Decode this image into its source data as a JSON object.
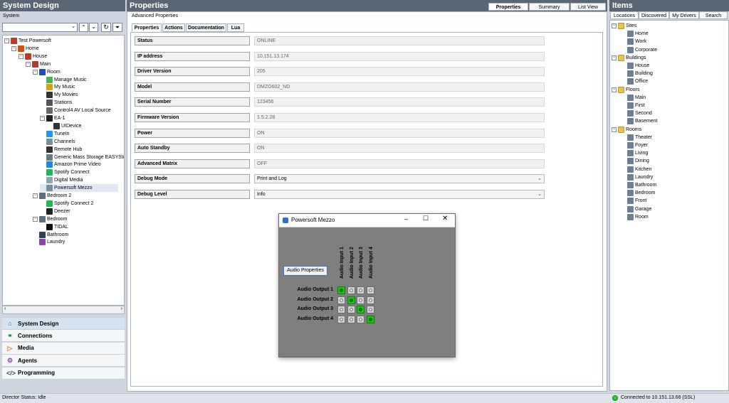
{
  "left": {
    "title": "System Design",
    "subtitle": "System",
    "tree": [
      {
        "label": "Test Powersoft",
        "indent": 0,
        "icon": "project-icon",
        "color": "#c0392b",
        "exp": "-"
      },
      {
        "label": "Home",
        "indent": 1,
        "icon": "home-site-icon",
        "color": "#d35400",
        "exp": "-"
      },
      {
        "label": "House",
        "indent": 2,
        "icon": "house-icon",
        "color": "#c0392b",
        "exp": "-"
      },
      {
        "label": "Main",
        "indent": 3,
        "icon": "floor-icon",
        "color": "#b03a2e",
        "exp": "-"
      },
      {
        "label": "Room",
        "indent": 4,
        "icon": "room-icon",
        "color": "#1f4fb0",
        "exp": "-"
      },
      {
        "label": "Manage Music",
        "indent": 5,
        "icon": "music-icon",
        "color": "#4caf50",
        "exp": ""
      },
      {
        "label": "My Music",
        "indent": 5,
        "icon": "my-music-icon",
        "color": "#d4a017",
        "exp": ""
      },
      {
        "label": "My Movies",
        "indent": 5,
        "icon": "movies-icon",
        "color": "#333333",
        "exp": ""
      },
      {
        "label": "Stations",
        "indent": 5,
        "icon": "stations-icon",
        "color": "#555555",
        "exp": ""
      },
      {
        "label": "Control4 AV Local Source",
        "indent": 5,
        "icon": "av-source-icon",
        "color": "#666666",
        "exp": ""
      },
      {
        "label": "EA-1",
        "indent": 5,
        "icon": "controller-icon",
        "color": "#222222",
        "exp": "-"
      },
      {
        "label": "UIDevice",
        "indent": 6,
        "icon": "uidevice-icon",
        "color": "#333333",
        "exp": ""
      },
      {
        "label": "TuneIn",
        "indent": 5,
        "icon": "tunein-icon",
        "color": "#2196f3",
        "exp": ""
      },
      {
        "label": "Channels",
        "indent": 5,
        "icon": "channels-icon",
        "color": "#78909c",
        "exp": ""
      },
      {
        "label": "Remote Hub",
        "indent": 5,
        "icon": "remote-hub-icon",
        "color": "#333333",
        "exp": ""
      },
      {
        "label": "Generic Mass Storage EASYSW",
        "indent": 5,
        "icon": "storage-icon",
        "color": "#607d8b",
        "exp": ""
      },
      {
        "label": "Amazon Prime Video",
        "indent": 5,
        "icon": "prime-video-icon",
        "color": "#1e88e5",
        "exp": ""
      },
      {
        "label": "Spotify Connect",
        "indent": 5,
        "icon": "spotify-icon",
        "color": "#1db954",
        "exp": ""
      },
      {
        "label": "Digital Media",
        "indent": 5,
        "icon": "digital-media-icon",
        "color": "#90a4ae",
        "exp": ""
      },
      {
        "label": "Powersoft Mezzo",
        "indent": 5,
        "icon": "amplifier-icon",
        "color": "#78909c",
        "exp": "",
        "selected": true
      },
      {
        "label": "Bedroom 2",
        "indent": 4,
        "icon": "bedroom-icon",
        "color": "#5d6d7e",
        "exp": "-"
      },
      {
        "label": "Spotify Connect 2",
        "indent": 5,
        "icon": "spotify-icon",
        "color": "#1db954",
        "exp": ""
      },
      {
        "label": "Deezer",
        "indent": 5,
        "icon": "deezer-icon",
        "color": "#222222",
        "exp": ""
      },
      {
        "label": "Bedroom",
        "indent": 4,
        "icon": "bedroom-icon",
        "color": "#5d6d7e",
        "exp": "-"
      },
      {
        "label": "TIDAL",
        "indent": 5,
        "icon": "tidal-icon",
        "color": "#111111",
        "exp": ""
      },
      {
        "label": "Bathroom",
        "indent": 4,
        "icon": "bathroom-icon",
        "color": "#2e4053",
        "exp": ""
      },
      {
        "label": "Laundry",
        "indent": 4,
        "icon": "laundry-icon",
        "color": "#8e44ad",
        "exp": ""
      }
    ],
    "nav": [
      {
        "label": "System Design",
        "icon": "home-outline-icon",
        "glyph": "⌂",
        "color": "#1f6fb5",
        "selected": true
      },
      {
        "label": "Connections",
        "icon": "connections-icon",
        "glyph": "⚭",
        "color": "#2e8b57"
      },
      {
        "label": "Media",
        "icon": "media-play-icon",
        "glyph": "▷",
        "color": "#e67e22"
      },
      {
        "label": "Agents",
        "icon": "agents-icon",
        "glyph": "⚙",
        "color": "#8e44ad"
      },
      {
        "label": "Programming",
        "icon": "code-icon",
        "glyph": "</>",
        "color": "#444444"
      }
    ]
  },
  "center": {
    "title": "Properties",
    "view_tabs": [
      "Properties",
      "Summary",
      "List View"
    ],
    "breadcrumb": "Advanced Properties",
    "sub_tabs": [
      "Properties",
      "Actions",
      "Documentation",
      "Lua"
    ],
    "props": [
      {
        "label": "Status",
        "value": "ONLINE",
        "dropdown": false
      },
      {
        "label": "IP address",
        "value": "10.151.13.174",
        "dropdown": false
      },
      {
        "label": "Driver Version",
        "value": "205",
        "dropdown": false
      },
      {
        "label": "Model",
        "value": "DMZO602_ND",
        "dropdown": false
      },
      {
        "label": "Serial Number",
        "value": "123456",
        "dropdown": false
      },
      {
        "label": "Firmware Version",
        "value": "1.5.2.28",
        "dropdown": false
      },
      {
        "label": "Power",
        "value": "ON",
        "dropdown": false
      },
      {
        "label": "Auto Standby",
        "value": "ON",
        "dropdown": false
      },
      {
        "label": "Advanced Matrix",
        "value": "OFF",
        "dropdown": false
      },
      {
        "label": "Debug Mode",
        "value": "Print and Log",
        "dropdown": true
      },
      {
        "label": "Debug Level",
        "value": "Info",
        "dropdown": true
      }
    ]
  },
  "dialog": {
    "title": "Powersoft Mezzo",
    "button": "Audio Properties",
    "inputs": [
      "Audio Input 1",
      "Audio Input 2",
      "Audio Input 3",
      "Audio Input 4"
    ],
    "outputs": [
      "Audio Output 1",
      "Audio Output 2",
      "Audio Output 3",
      "Audio Output 4"
    ],
    "matrix": [
      [
        1,
        0,
        0,
        0
      ],
      [
        0,
        1,
        0,
        0
      ],
      [
        0,
        0,
        1,
        0
      ],
      [
        0,
        0,
        0,
        1
      ]
    ],
    "active_color": "#1fc21a"
  },
  "right": {
    "title": "Items",
    "tabs": [
      "Locations",
      "Discovered",
      "My Drivers",
      "Search"
    ],
    "groups": [
      {
        "label": "Sites",
        "items": [
          {
            "label": "Home",
            "icon": "site-home-icon"
          },
          {
            "label": "Work",
            "icon": "site-work-icon"
          },
          {
            "label": "Corporate",
            "icon": "site-corporate-icon"
          }
        ]
      },
      {
        "label": "Buildings",
        "items": [
          {
            "label": "House",
            "icon": "house-icon"
          },
          {
            "label": "Building",
            "icon": "building-icon"
          },
          {
            "label": "Office",
            "icon": "office-icon"
          }
        ]
      },
      {
        "label": "Floors",
        "items": [
          {
            "label": "Main",
            "icon": "floor-main-icon"
          },
          {
            "label": "First",
            "icon": "floor-first-icon"
          },
          {
            "label": "Second",
            "icon": "floor-second-icon"
          },
          {
            "label": "Basement",
            "icon": "floor-basement-icon"
          }
        ]
      },
      {
        "label": "Rooms",
        "items": [
          {
            "label": "Theater",
            "icon": "theater-icon"
          },
          {
            "label": "Foyer",
            "icon": "foyer-icon"
          },
          {
            "label": "Living",
            "icon": "living-icon"
          },
          {
            "label": "Dining",
            "icon": "dining-icon"
          },
          {
            "label": "Kitchen",
            "icon": "kitchen-icon"
          },
          {
            "label": "Laundry",
            "icon": "laundry-icon"
          },
          {
            "label": "Bathroom",
            "icon": "bathroom-icon"
          },
          {
            "label": "Bedroom",
            "icon": "bedroom-icon"
          },
          {
            "label": "Front",
            "icon": "front-icon"
          },
          {
            "label": "Garage",
            "icon": "garage-icon"
          },
          {
            "label": "Room",
            "icon": "room-icon"
          }
        ]
      }
    ]
  },
  "status": {
    "left": "Director Status: Idle",
    "right": "Connected to 10.151.13.66 (SSL)",
    "indicator_color": "#2ecc40"
  }
}
